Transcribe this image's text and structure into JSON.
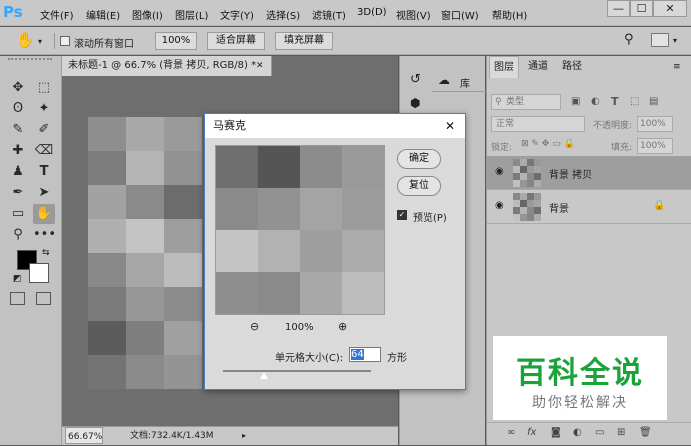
{
  "app": {
    "logo": "Ps"
  },
  "menu": [
    "文件(F)",
    "编辑(E)",
    "图像(I)",
    "图层(L)",
    "文字(Y)",
    "选择(S)",
    "滤镜(T)",
    "3D(D)",
    "视图(V)",
    "窗口(W)",
    "帮助(H)"
  ],
  "window_controls": {
    "minimize": "—",
    "restore": "☐",
    "close": "✕"
  },
  "options": {
    "scroll_all_label": "滚动所有窗口",
    "zoom_value": "100%",
    "fit_screen": "适合屏幕",
    "fill_screen": "填充屏幕"
  },
  "document": {
    "tab_title": "未标题-1 @ 66.7% (背景 拷贝, RGB/8) *",
    "zoom": "66.67%",
    "doc_info": "文档:732.4K/1.43M"
  },
  "mid_panel": {
    "library_label": "库"
  },
  "layers_panel": {
    "tabs": [
      "图层",
      "通道",
      "路径"
    ],
    "kind_filter": "类型",
    "blend_mode": "正常",
    "opacity_label": "不透明度:",
    "opacity_value": "100%",
    "lock_label": "锁定:",
    "fill_label": "填充:",
    "fill_value": "100%",
    "layers": [
      {
        "name": "背景 拷贝",
        "selected": true,
        "locked": false
      },
      {
        "name": "背景",
        "selected": false,
        "locked": true
      }
    ]
  },
  "dialog": {
    "title": "马赛克",
    "ok": "确定",
    "reset": "复位",
    "preview_label": "预览(P)",
    "preview_checked": true,
    "zoom": "100%",
    "cell_size_label": "单元格大小(C):",
    "cell_size_value": "64",
    "unit": "方形"
  },
  "watermark": {
    "title": "百科全说",
    "subtitle": "助你轻松解决"
  },
  "colors": {
    "accent": "#4a7fc1",
    "watermark_green": "#1aa33a",
    "ps_blue": "#31a8ff"
  }
}
